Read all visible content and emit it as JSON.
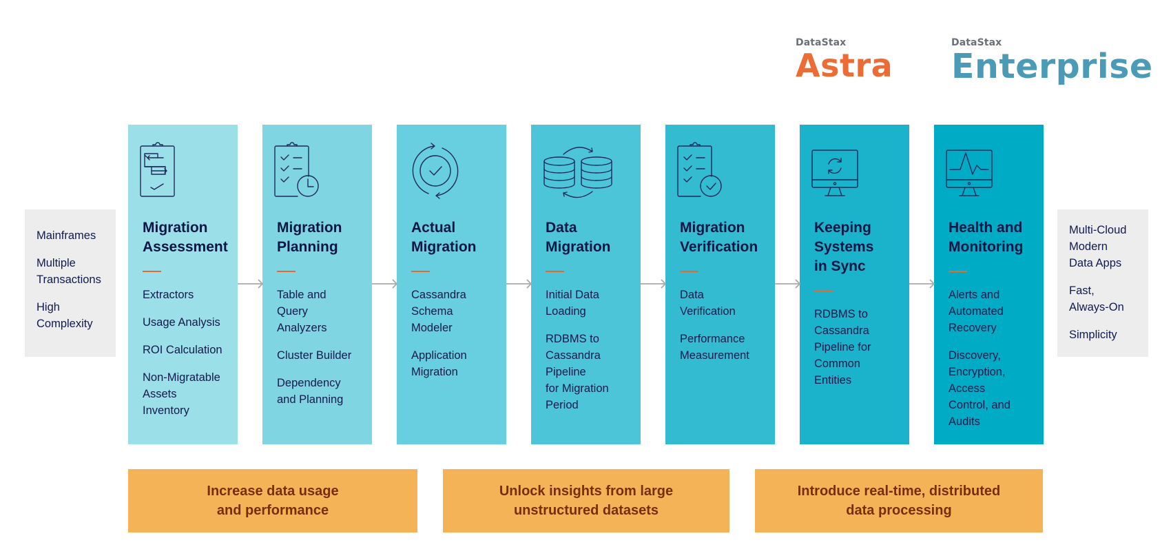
{
  "logos": {
    "astra": {
      "brand": "DataStax",
      "product": "Astra",
      "color": "#ec6c35"
    },
    "enterprise": {
      "brand": "DataStax",
      "product": "Enterprise",
      "color": "#4b9bb6"
    }
  },
  "source": {
    "items": [
      "Mainframes",
      "Multiple\nTransactions",
      "High\nComplexity"
    ]
  },
  "target": {
    "items": [
      "Multi-Cloud\nModern\nData Apps",
      "Fast,\nAlways-On",
      "Simplicity"
    ]
  },
  "stages": [
    {
      "title": "Migration\nAssessment",
      "icon": "clipboard-transfer-icon",
      "color": "#9bdfe9",
      "items": [
        "Extractors",
        "Usage Analysis",
        "ROI Calculation",
        "Non-Migratable\nAssets\nInventory"
      ]
    },
    {
      "title": "Migration\nPlanning",
      "icon": "checklist-clock-icon",
      "color": "#7fd5e2",
      "items": [
        "Table and\nQuery\nAnalyzers",
        "Cluster Builder",
        "Dependency\nand Planning"
      ]
    },
    {
      "title": "Actual\nMigration",
      "icon": "cycle-check-icon",
      "color": "#67cfdf",
      "items": [
        "Cassandra\nSchema\nModeler",
        "Application\nMigration"
      ]
    },
    {
      "title": "Data\nMigration",
      "icon": "database-sync-icon",
      "color": "#4dc5d8",
      "items": [
        "Initial Data\nLoading",
        "RDBMS to\nCassandra\nPipeline\nfor Migration\nPeriod"
      ]
    },
    {
      "title": "Migration\nVerification",
      "icon": "checklist-verified-icon",
      "color": "#33bcd1",
      "items": [
        "Data\nVerification",
        "Performance\nMeasurement"
      ]
    },
    {
      "title": "Keeping\nSystems\nin Sync",
      "icon": "monitor-sync-icon",
      "color": "#1bb3cb",
      "items": [
        "RDBMS to\nCassandra\nPipeline for\nCommon\nEntities"
      ]
    },
    {
      "title": "Health and\nMonitoring",
      "icon": "monitor-pulse-icon",
      "color": "#00abc5",
      "items": [
        "Alerts and\nAutomated\nRecovery",
        "Discovery,\nEncryption,\nAccess\nControl, and\nAudits"
      ]
    }
  ],
  "goals": [
    {
      "text": "Increase data usage\nand performance"
    },
    {
      "text": "Unlock insights from large\nunstructured datasets"
    },
    {
      "text": "Introduce real-time, distributed\ndata processing"
    }
  ],
  "colors": {
    "accent_dash": "#e8692f",
    "arrow": "#a9a9a9",
    "goal_bg": "#f5b357",
    "goal_text": "#7a2d0c",
    "text": "#101a4c",
    "side_bg": "#ededed"
  }
}
